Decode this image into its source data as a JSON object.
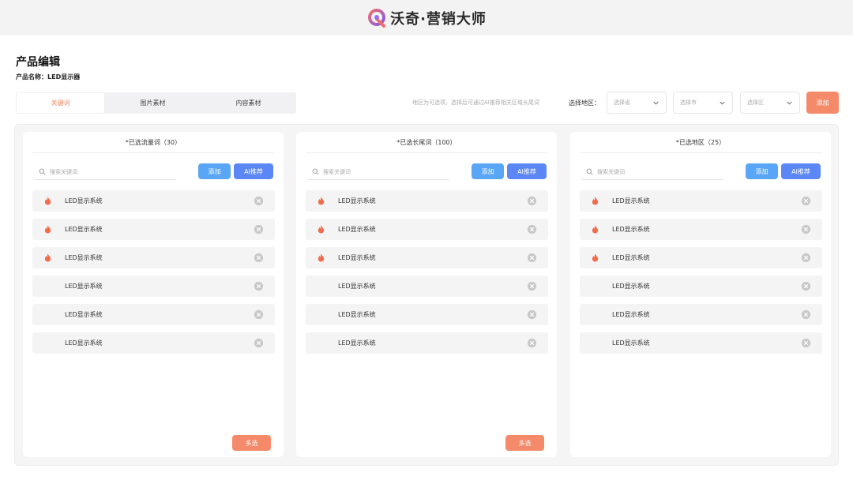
{
  "header": {
    "brand": "沃奇·营销大师"
  },
  "page": {
    "title": "产品编辑",
    "product_label": "产品名称：",
    "product_value": "LED显示器"
  },
  "tabs": [
    {
      "label": "关键词",
      "active": true
    },
    {
      "label": "图片素材",
      "active": false
    },
    {
      "label": "内容素材",
      "active": false
    }
  ],
  "region": {
    "hint": "地区为可选项，选择后可通过AI推荐相关区域长尾词",
    "label": "选择地区：",
    "province_placeholder": "选择省",
    "city_placeholder": "选择市",
    "district_placeholder": "选择区",
    "add_label": "添加"
  },
  "panels": [
    {
      "title": "*已选流量词（30）",
      "search_placeholder": "搜索关键词",
      "add_label": "添加",
      "ai_label": "AI推荐",
      "multi_label": "多选",
      "items": [
        {
          "text": "LED显示系统",
          "hot": true
        },
        {
          "text": "LED显示系统",
          "hot": true
        },
        {
          "text": "LED显示系统",
          "hot": true
        },
        {
          "text": "LED显示系统",
          "hot": false
        },
        {
          "text": "LED显示系统",
          "hot": false
        },
        {
          "text": "LED显示系统",
          "hot": false
        }
      ]
    },
    {
      "title": "*已选长尾词（100）",
      "search_placeholder": "搜索关键词",
      "add_label": "添加",
      "ai_label": "AI推荐",
      "multi_label": "多选",
      "items": [
        {
          "text": "LED显示系统",
          "hot": true
        },
        {
          "text": "LED显示系统",
          "hot": true
        },
        {
          "text": "LED显示系统",
          "hot": true
        },
        {
          "text": "LED显示系统",
          "hot": false
        },
        {
          "text": "LED显示系统",
          "hot": false
        },
        {
          "text": "LED显示系统",
          "hot": false
        }
      ]
    },
    {
      "title": "*已选地区（25）",
      "search_placeholder": "搜索关键词",
      "add_label": "添加",
      "ai_label": "AI推荐",
      "items": [
        {
          "text": "LED显示系统",
          "hot": true
        },
        {
          "text": "LED显示系统",
          "hot": true
        },
        {
          "text": "LED显示系统",
          "hot": true
        },
        {
          "text": "LED显示系统",
          "hot": false
        },
        {
          "text": "LED显示系统",
          "hot": false
        },
        {
          "text": "LED显示系统",
          "hot": false
        }
      ]
    }
  ],
  "colors": {
    "accent": "#f58a6a",
    "primary": "#59a6f7",
    "ai": "#5b86f5",
    "hot": "#f26b4a"
  },
  "icons": {
    "item_hot": "fire-icon",
    "item_remove": "close-circle-icon",
    "search": "search-icon",
    "select": "chevron-down-icon"
  }
}
